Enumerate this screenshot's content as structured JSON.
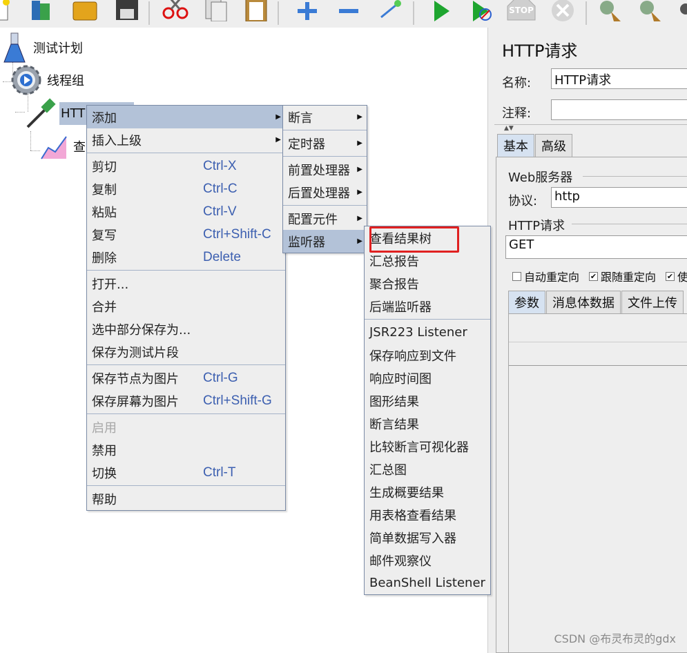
{
  "tree": {
    "test_plan": "测试计划",
    "thread_group": "线程组",
    "http_node": "HTTP",
    "child_node": "查"
  },
  "right_panel": {
    "title": "HTTP请求",
    "name_label": "名称:",
    "name_value": "HTTP请求",
    "comment_label": "注释:",
    "comment_value": "",
    "tabs": [
      "基本",
      "高级"
    ],
    "web_server_label": "Web服务器",
    "protocol_label": "协议:",
    "protocol_value": "http",
    "http_request_label": "HTTP请求",
    "method_value": "GET",
    "checks": [
      {
        "label": "自动重定向",
        "checked": false
      },
      {
        "label": "跟随重定向",
        "checked": true
      },
      {
        "label": "使",
        "checked": true
      }
    ],
    "param_tabs": [
      "参数",
      "消息体数据",
      "文件上传"
    ]
  },
  "context_menu": {
    "items": [
      {
        "label": "添加",
        "submenu": true,
        "highlight": true
      },
      {
        "label": "插入上级",
        "submenu": true
      },
      {
        "sep": true
      },
      {
        "label": "剪切",
        "accel": "Ctrl-X"
      },
      {
        "label": "复制",
        "accel": "Ctrl-C"
      },
      {
        "label": "粘贴",
        "accel": "Ctrl-V"
      },
      {
        "label": "复写",
        "accel": "Ctrl+Shift-C"
      },
      {
        "label": "删除",
        "accel": "Delete"
      },
      {
        "sep": true
      },
      {
        "label": "打开..."
      },
      {
        "label": "合并"
      },
      {
        "label": "选中部分保存为..."
      },
      {
        "label": "保存为测试片段"
      },
      {
        "sep": true
      },
      {
        "label": "保存节点为图片",
        "accel": "Ctrl-G"
      },
      {
        "label": "保存屏幕为图片",
        "accel": "Ctrl+Shift-G"
      },
      {
        "sep": true
      },
      {
        "label": "启用",
        "disabled": true
      },
      {
        "label": "禁用"
      },
      {
        "label": "切换",
        "accel": "Ctrl-T"
      },
      {
        "sep": true
      },
      {
        "label": "帮助"
      }
    ]
  },
  "add_submenu": {
    "items": [
      {
        "label": "断言",
        "submenu": true
      },
      {
        "sep": true
      },
      {
        "label": "定时器",
        "submenu": true
      },
      {
        "sep": true
      },
      {
        "label": "前置处理器",
        "submenu": true
      },
      {
        "label": "后置处理器",
        "submenu": true
      },
      {
        "sep": true
      },
      {
        "label": "配置元件",
        "submenu": true
      },
      {
        "label": "监听器",
        "submenu": true,
        "highlight": true
      }
    ]
  },
  "listener_submenu": {
    "items": [
      {
        "label": "查看结果树",
        "boxed": true
      },
      {
        "label": "汇总报告"
      },
      {
        "label": "聚合报告"
      },
      {
        "label": "后端监听器"
      },
      {
        "sep": true
      },
      {
        "label": "JSR223 Listener"
      },
      {
        "label": "保存响应到文件"
      },
      {
        "label": "响应时间图"
      },
      {
        "label": "图形结果"
      },
      {
        "label": "断言结果"
      },
      {
        "label": "比较断言可视化器"
      },
      {
        "label": "汇总图"
      },
      {
        "label": "生成概要结果"
      },
      {
        "label": "用表格查看结果"
      },
      {
        "label": "简单数据写入器"
      },
      {
        "label": "邮件观察仪"
      },
      {
        "label": "BeanShell Listener"
      }
    ]
  },
  "toolbar": {
    "icons": [
      "new-icon",
      "templates-icon",
      "open-icon",
      "save-icon",
      "cut-icon",
      "copy-icon",
      "paste-icon",
      "expand-icon",
      "collapse-icon",
      "toggle-icon",
      "start-icon",
      "start-no-pause-icon",
      "stop-icon",
      "shutdown-icon",
      "clear-icon",
      "clear-all-icon",
      "search-icon"
    ],
    "stop_text": "STOP"
  },
  "watermark": "CSDN @布灵布灵的gdx",
  "colors": {
    "menu_bg": "#eeeeee",
    "highlight": "#b3c2d8",
    "accelerator": "#3c5fb0",
    "red_box": "#e02020"
  }
}
